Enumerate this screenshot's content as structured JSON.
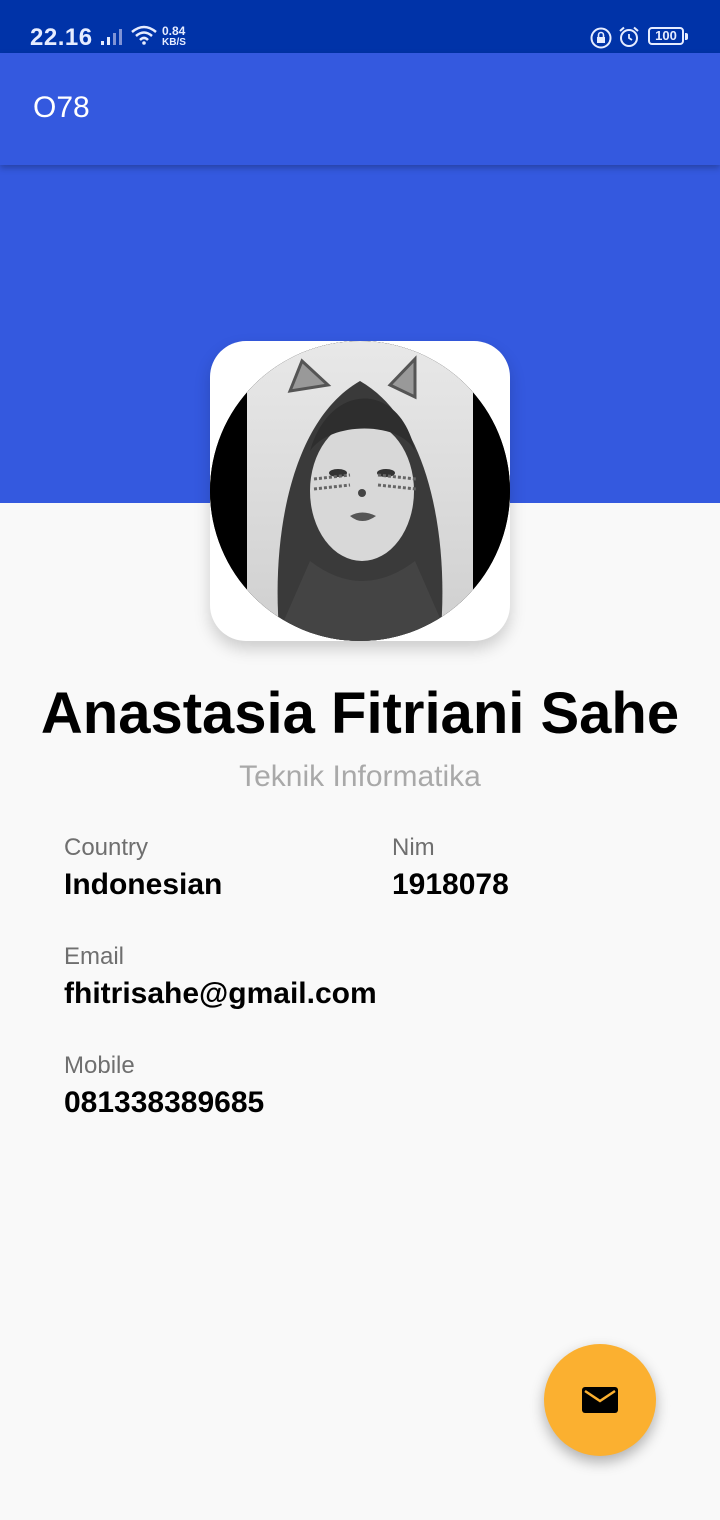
{
  "status_bar": {
    "time": "22.16",
    "net_speed_value": "0.84",
    "net_speed_unit": "KB/S",
    "battery": "100",
    "icons": [
      "signal-icon",
      "wifi-icon",
      "lock-icon",
      "alarm-icon",
      "battery-icon"
    ]
  },
  "app_bar": {
    "title": "O78"
  },
  "profile": {
    "name": "Anastasia Fitriani Sahe",
    "department": "Teknik Informatika"
  },
  "fields": {
    "country_label": "Country",
    "country_value": "Indonesian",
    "nim_label": "Nim",
    "nim_value": "1918078",
    "email_label": "Email",
    "email_value": "fhitrisahe@gmail.com",
    "mobile_label": "Mobile",
    "mobile_value": "081338389685"
  },
  "fab": {
    "icon": "mail-icon"
  },
  "colors": {
    "status_bar": "#0033a8",
    "app_bar": "#3459df",
    "fab": "#fbb030",
    "background": "#f9f9f9"
  }
}
